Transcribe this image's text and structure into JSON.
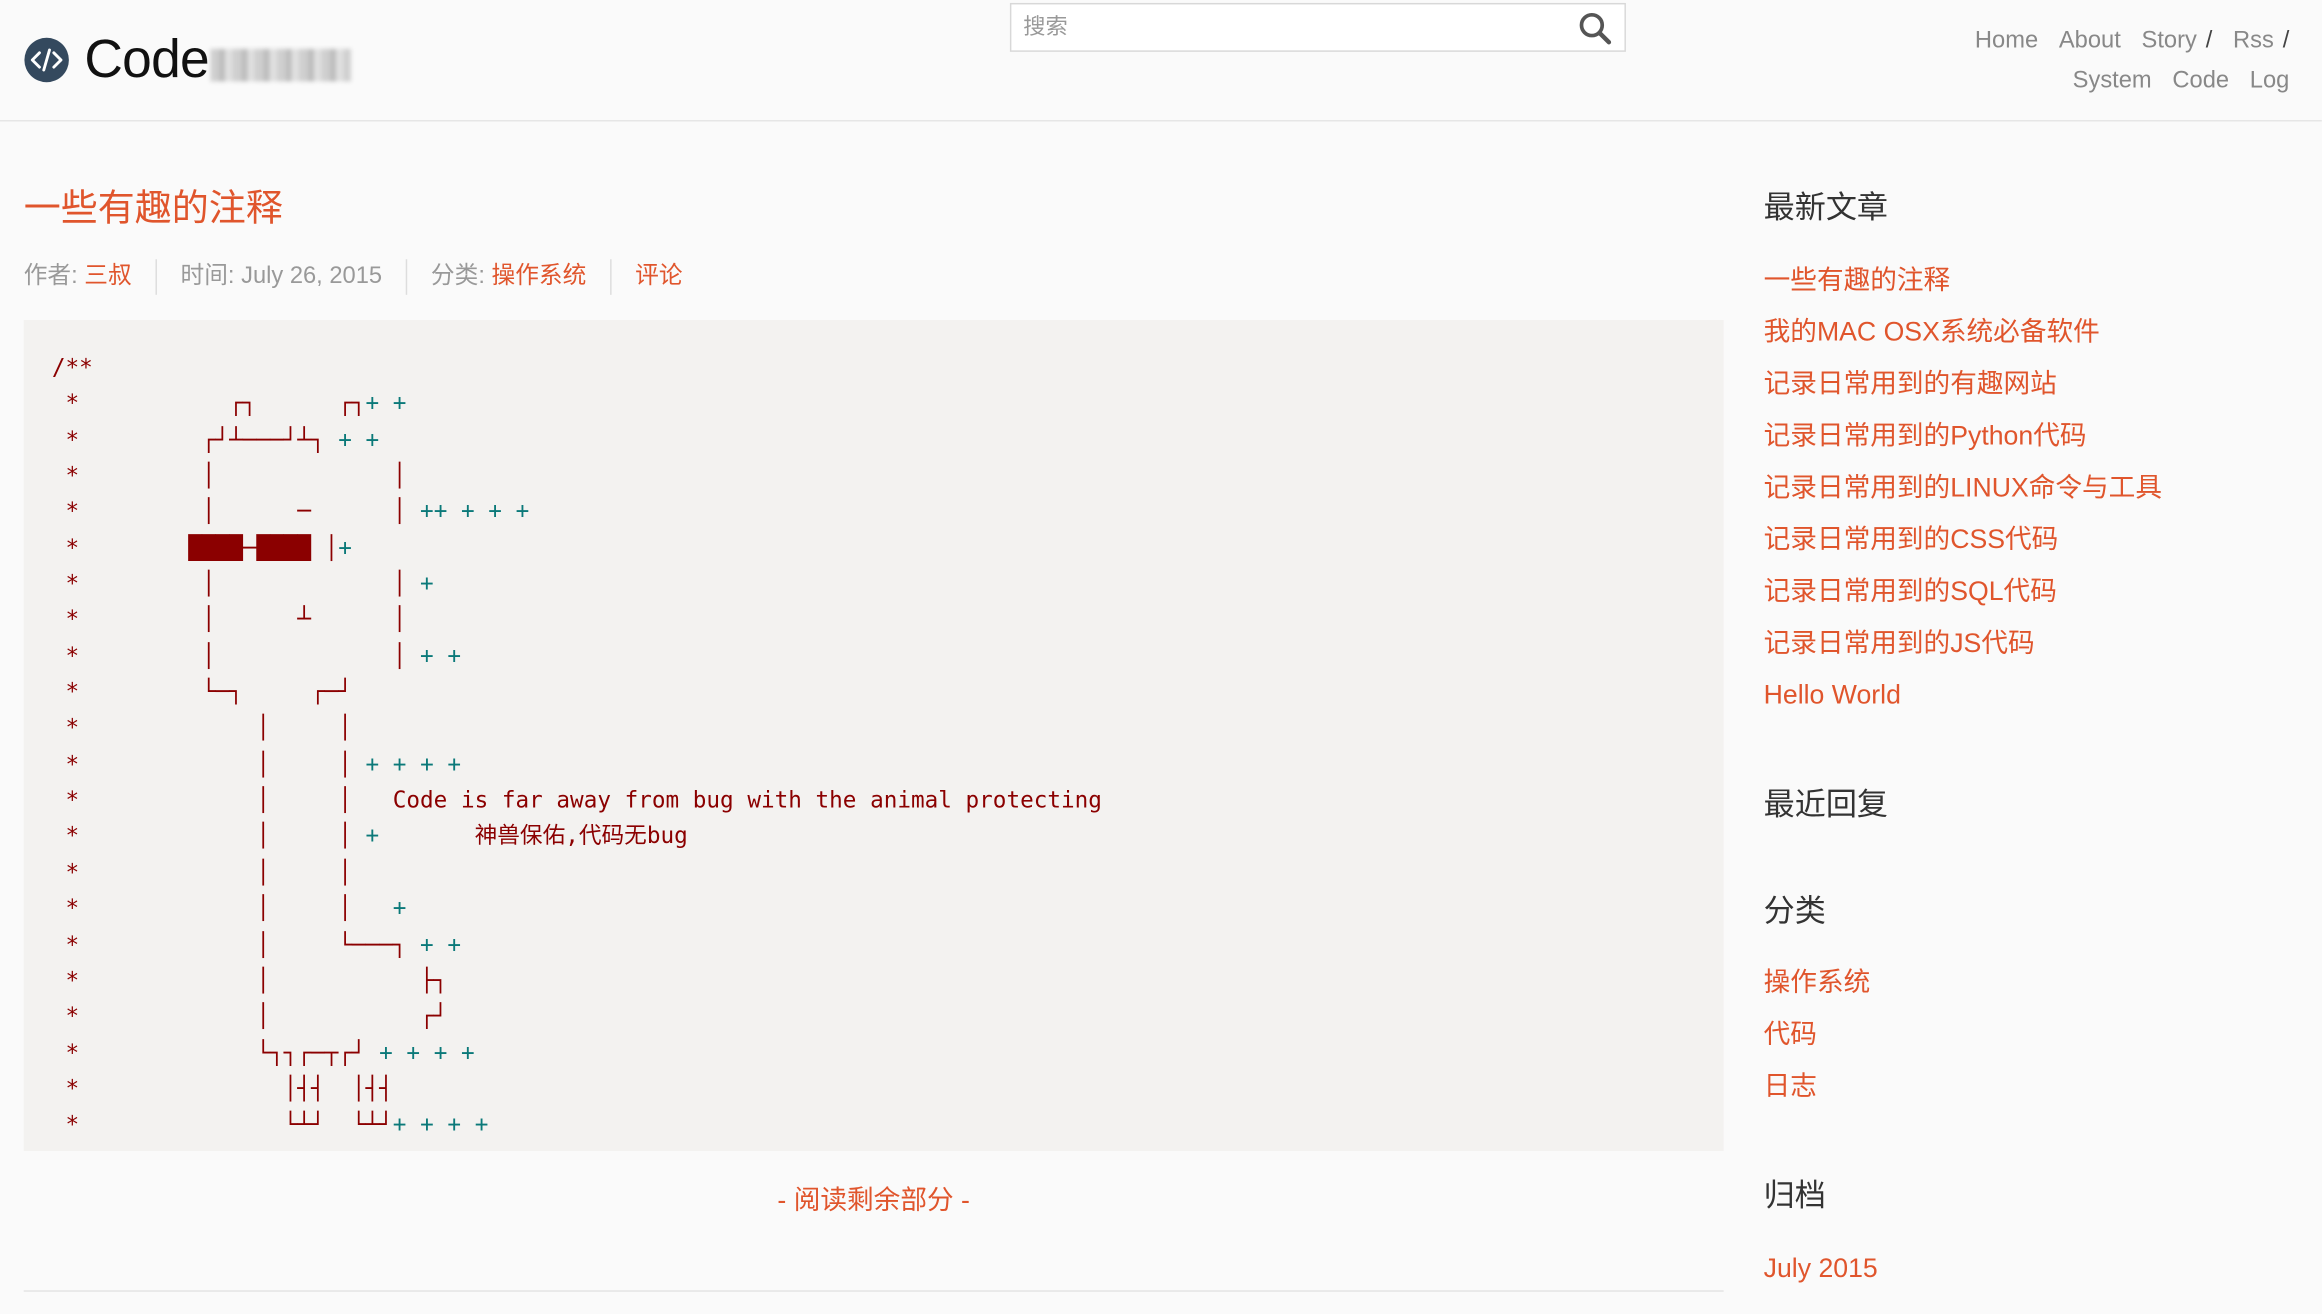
{
  "header": {
    "logo_text": "Code",
    "search_placeholder": "搜索",
    "nav_row1": [
      {
        "label": "Home",
        "name": "nav-home"
      },
      {
        "label": "About",
        "name": "nav-about"
      },
      {
        "label": "Story",
        "name": "nav-story"
      }
    ],
    "nav_row1_rest": [
      {
        "label": "Rss",
        "name": "nav-rss"
      }
    ],
    "nav_sep": "/",
    "nav_row2": [
      {
        "label": "System",
        "name": "nav-system"
      },
      {
        "label": "Code",
        "name": "nav-code"
      },
      {
        "label": "Log",
        "name": "nav-log"
      }
    ]
  },
  "post": {
    "title": "一些有趣的注释",
    "author_label": "作者: ",
    "author": "三叔",
    "time_label": "时间: ",
    "time": "July 26, 2015",
    "category_label": "分类: ",
    "category": "操作系统",
    "comments": "评论",
    "code_lines": [
      "/**",
      " *           ┌┐      ┌┐+ +",
      " *         ┌┘┴───┘┴┐ + +",
      " *         │             │",
      " *         │      ─      │ ++ + + +",
      " *        ████─████ │+",
      " *         │             │ +",
      " *         │      ┴      │",
      " *         │             │ + +",
      " *         └─┐     ┌─┘",
      " *             │     │",
      " *             │     │ + + + +",
      " *             │     │   Code is far away from bug with the animal protecting",
      " *             │     │ +       神兽保佑,代码无bug",
      " *             │     │",
      " *             │     │   +",
      " *             │     └───┐ + +",
      " *             │           ├┐",
      " *             │           ┌┘",
      " *             └┐┐┌─┬┌┘ + + + +",
      " *               │┤┤  │┤┤",
      " *               └┴┘  └┴┘+ + + +",
      " */"
    ],
    "read_more": "- 阅读剩余部分 -"
  },
  "sidebar": {
    "recent_posts_title": "最新文章",
    "recent_posts": [
      "一些有趣的注释",
      "我的MAC OSX系统必备软件",
      "记录日常用到的有趣网站",
      "记录日常用到的Python代码",
      "记录日常用到的LINUX命令与工具",
      "记录日常用到的CSS代码",
      "记录日常用到的SQL代码",
      "记录日常用到的JS代码",
      "Hello World"
    ],
    "recent_comments_title": "最近回复",
    "categories_title": "分类",
    "categories": [
      "操作系统",
      "代码",
      "日志"
    ],
    "archive_title": "归档",
    "archives": [
      "July 2015"
    ]
  },
  "colors": {
    "accent": "#e0552c",
    "code_bg": "#f3f2f0",
    "code_text": "#8b0000",
    "code_plus": "#0b7979"
  }
}
